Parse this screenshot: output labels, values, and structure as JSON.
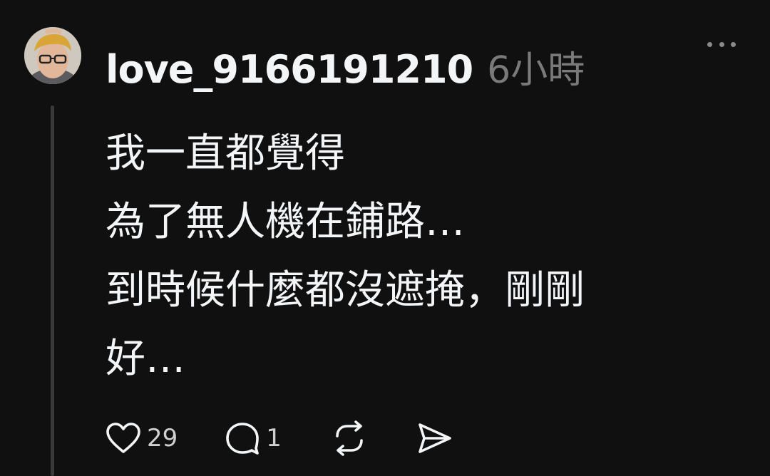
{
  "post": {
    "username": "love_9166191210",
    "timestamp": "6小時",
    "avatar_icon": "user-avatar-photo",
    "text_lines": [
      "我一直都覺得",
      "為了無人機在鋪路…",
      "到時候什麼都沒遮掩，剛剛",
      "好…"
    ]
  },
  "actions": {
    "like_count": "29",
    "reply_count": "1",
    "like_icon": "heart-icon",
    "reply_icon": "speech-bubble-icon",
    "repost_icon": "repost-icon",
    "share_icon": "send-icon"
  },
  "menu": {
    "more_icon": "more-dots-icon"
  },
  "colors": {
    "background": "#101010",
    "primary_text": "#f3f5f7",
    "secondary_text": "#7a7a7a",
    "thread_line": "#3a3a3a"
  }
}
